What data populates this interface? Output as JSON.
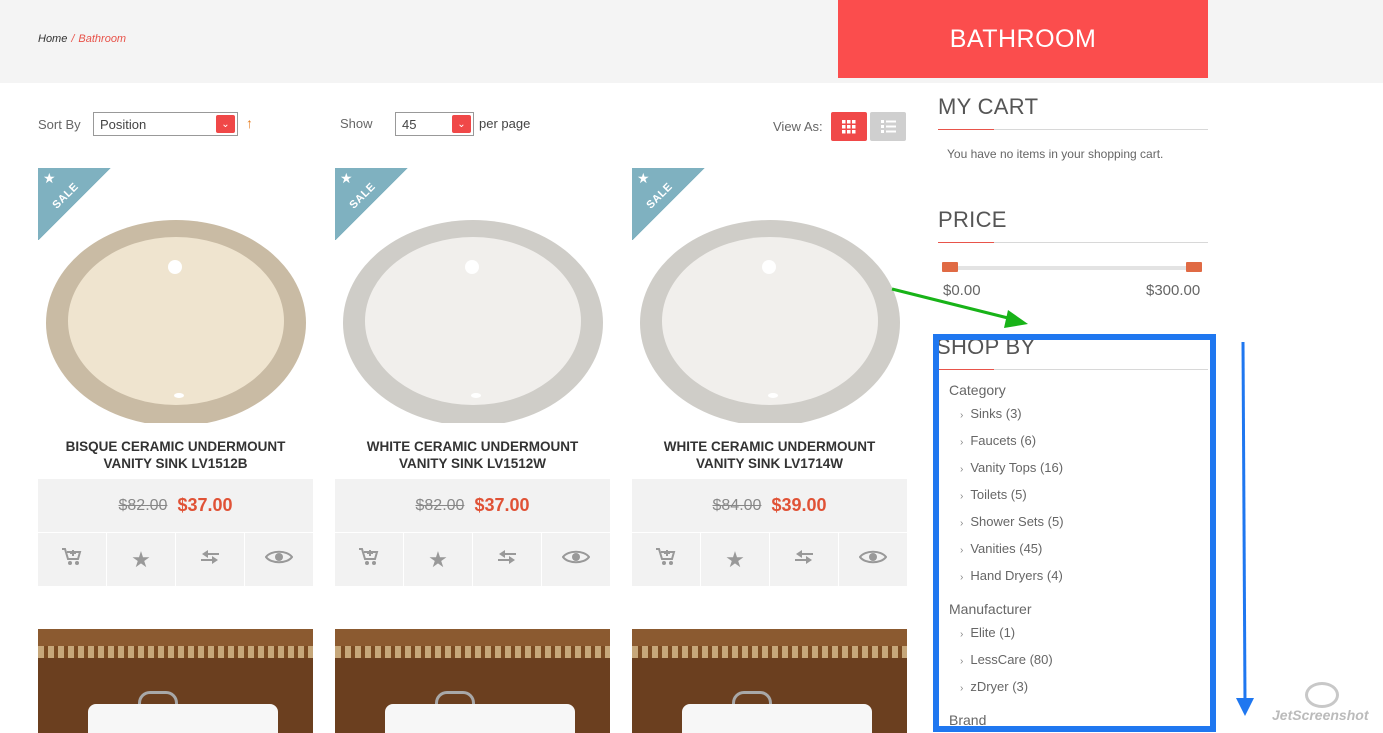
{
  "breadcrumb": {
    "home": "Home",
    "separator": "/",
    "current": "Bathroom"
  },
  "category_title": "BATHROOM",
  "toolbar": {
    "sort_label": "Sort By",
    "sort_value": "Position",
    "sort_direction_icon": "↑",
    "show_label": "Show",
    "show_value": "45",
    "per_page_label": "per page",
    "view_as_label": "View As:"
  },
  "products": [
    {
      "badge": "SALE",
      "name_line1": "BISQUE CERAMIC UNDERMOUNT",
      "name_line2": "VANITY SINK LV1512B",
      "old_price": "$82.00",
      "price": "$37.00",
      "rim_color": "#c9bba4",
      "bowl_color": "#efe4cf"
    },
    {
      "badge": "SALE",
      "name_line1": "WHITE CERAMIC UNDERMOUNT",
      "name_line2": "VANITY SINK LV1512W",
      "old_price": "$82.00",
      "price": "$37.00",
      "rim_color": "#cfcdc8",
      "bowl_color": "#f1efec"
    },
    {
      "badge": "SALE",
      "name_line1": "WHITE CERAMIC UNDERMOUNT",
      "name_line2": "VANITY SINK LV1714W",
      "old_price": "$84.00",
      "price": "$39.00",
      "rim_color": "#cfcdc8",
      "bowl_color": "#f1efec"
    }
  ],
  "product_actions": [
    "add-to-cart-icon",
    "wishlist-star-icon",
    "compare-icon",
    "quick-view-eye-icon"
  ],
  "sidebar": {
    "cart_title": "MY CART",
    "cart_message": "You have no items in your shopping cart.",
    "price_title": "PRICE",
    "price_min": "$0.00",
    "price_max": "$300.00",
    "shop_by_title": "SHOP BY",
    "category_label": "Category",
    "categories": [
      "Sinks (3)",
      "Faucets (6)",
      "Vanity Tops (16)",
      "Toilets (5)",
      "Shower Sets (5)",
      "Vanities (45)",
      "Hand Dryers (4)"
    ],
    "manufacturer_label": "Manufacturer",
    "manufacturers": [
      "Elite (1)",
      "LessCare (80)",
      "zDryer (3)"
    ],
    "brand_label": "Brand"
  },
  "watermark": "JetScreenshot",
  "colors": {
    "accent": "#fb4d4d",
    "price": "#e05236",
    "annotation_box": "#1f77f0",
    "annotation_arrow_green": "#18b318"
  }
}
